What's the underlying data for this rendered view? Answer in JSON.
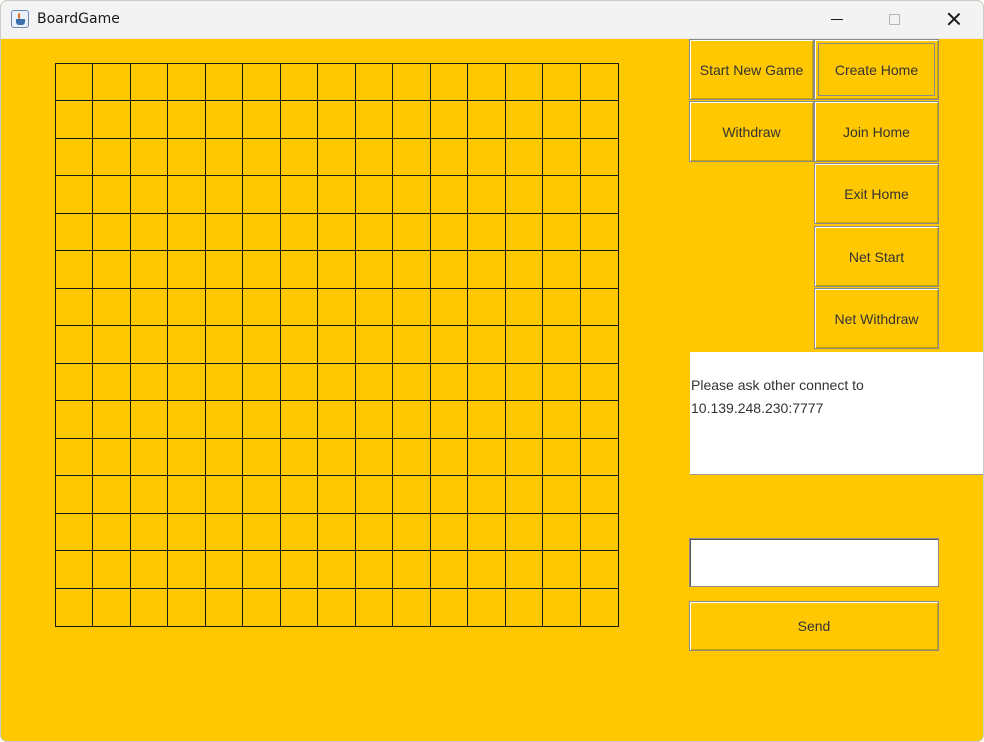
{
  "window": {
    "title": "BoardGame",
    "background_color": "#ffc800",
    "controls": [
      "minimize-icon",
      "maximize-icon",
      "close-icon"
    ]
  },
  "board": {
    "rows": 15,
    "columns": 15,
    "line_color": "#1a1a1a"
  },
  "buttons": {
    "start_new_game": "Start New Game",
    "create_home": "Create Home",
    "withdraw": "Withdraw",
    "join_home": "Join Home",
    "exit_home": "Exit Home",
    "net_start": "Net Start",
    "net_withdraw": "Net Withdraw",
    "send": "Send"
  },
  "message_area": {
    "text": "Please ask other connect to\n10.139.248.230:7777"
  },
  "chat_input": {
    "value": "",
    "placeholder": ""
  }
}
